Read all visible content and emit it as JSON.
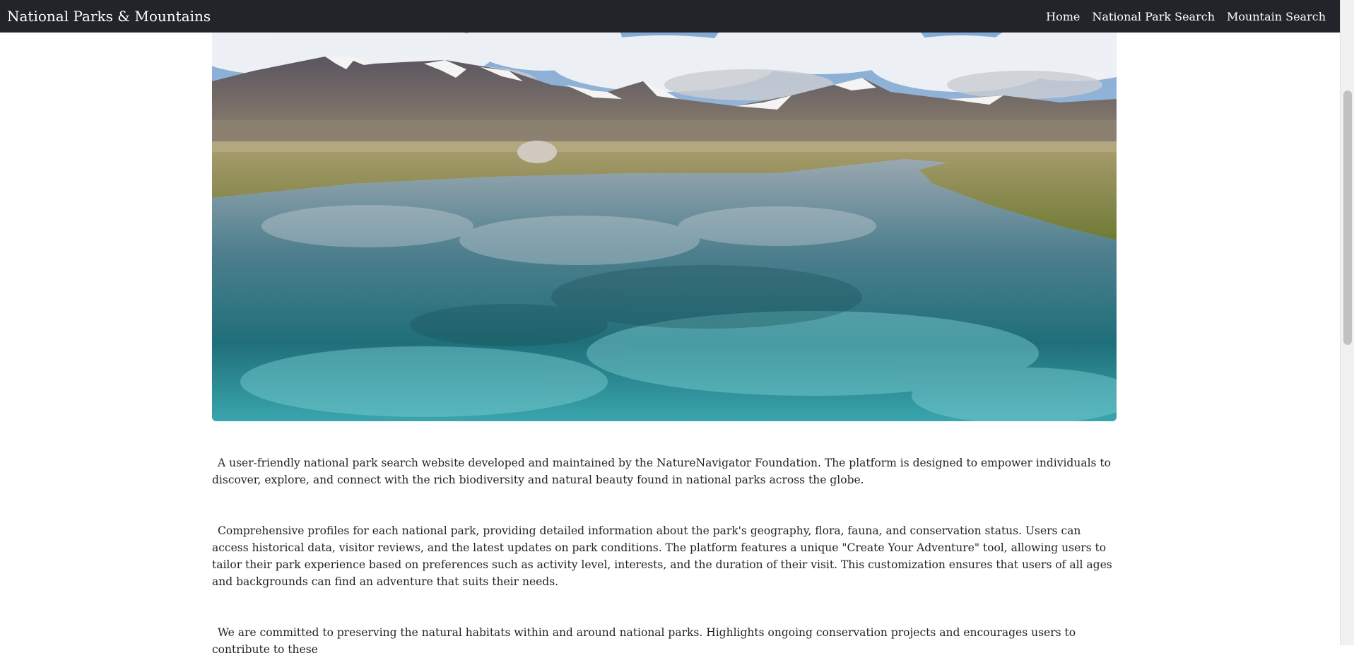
{
  "navbar": {
    "brand": "National Parks & Mountains",
    "links": [
      "Home",
      "National Park Search",
      "Mountain Search"
    ],
    "bg_color": "#212529"
  },
  "hero": {
    "alt": "Mountain lake landscape"
  },
  "content": {
    "paragraphs": [
      "A user-friendly national park search website developed and maintained by the NatureNavigator Foundation. The platform is designed to empower individuals to discover, explore, and connect with the rich biodiversity and natural beauty found in national parks across the globe.",
      "Comprehensive profiles for each national park, providing detailed information about the park's geography, flora, fauna, and conservation status. Users can access historical data, visitor reviews, and the latest updates on park conditions. The platform features a unique \"Create Your Adventure\" tool, allowing users to tailor their park experience based on preferences such as activity level, interests, and the duration of their visit. This customization ensures that users of all ages and backgrounds can find an adventure that suits their needs.",
      "We are committed to preserving the natural habitats within and around national parks. Highlights ongoing conservation projects and encourages users to contribute to these"
    ]
  }
}
